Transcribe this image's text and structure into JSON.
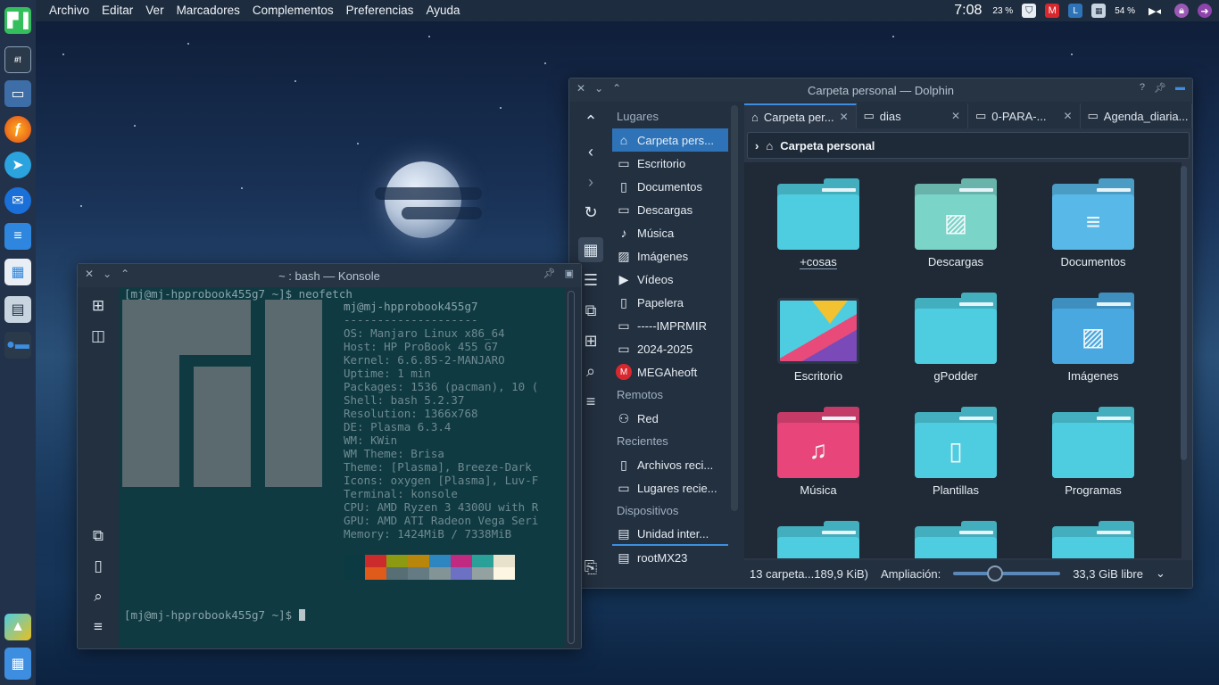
{
  "topbar": {
    "menu": [
      "Archivo",
      "Editar",
      "Ver",
      "Marcadores",
      "Complementos",
      "Preferencias",
      "Ayuda"
    ],
    "clock": "7:08",
    "battery": "23 %",
    "disk": "54 %",
    "tray_icons": [
      "shield-icon",
      "mega-icon",
      "keyboard-layout-icon",
      "calendar-icon",
      "media-icon",
      "lock-icon",
      "updates-icon"
    ]
  },
  "dock": {
    "icons": [
      "manjaro-logo-icon",
      "terminal-icon",
      "file-manager-icon",
      "firefox-icon",
      "telegram-icon",
      "thunderbird-icon",
      "writer-icon",
      "calc-icon",
      "impress-icon",
      "toggle-icon",
      "image-viewer-icon",
      "desktop-pager-icon"
    ]
  },
  "dolphin": {
    "title": "Carpeta personal — Dolphin",
    "places_header": "Lugares",
    "places": [
      {
        "label": "Carpeta pers...",
        "icon": "home-icon"
      },
      {
        "label": "Escritorio",
        "icon": "desktop-icon"
      },
      {
        "label": "Documentos",
        "icon": "document-icon"
      },
      {
        "label": "Descargas",
        "icon": "folder-icon"
      },
      {
        "label": "Música",
        "icon": "music-icon"
      },
      {
        "label": "Imágenes",
        "icon": "image-icon"
      },
      {
        "label": "Vídeos",
        "icon": "video-icon"
      },
      {
        "label": "Papelera",
        "icon": "trash-icon"
      },
      {
        "label": "-----IMPRMIR",
        "icon": "folder-icon"
      },
      {
        "label": "2024-2025",
        "icon": "folder-icon"
      },
      {
        "label": "MEGAheoft",
        "icon": "mega-icon"
      }
    ],
    "remote_header": "Remotos",
    "remote": [
      {
        "label": "Red",
        "icon": "network-icon"
      }
    ],
    "recent_header": "Recientes",
    "recent": [
      {
        "label": "Archivos reci...",
        "icon": "recent-files-icon"
      },
      {
        "label": "Lugares recie...",
        "icon": "recent-places-icon"
      }
    ],
    "devices_header": "Dispositivos",
    "devices": [
      {
        "label": "Unidad inter...",
        "icon": "drive-icon"
      },
      {
        "label": "rootMX23",
        "icon": "drive-icon"
      }
    ],
    "tabs": [
      {
        "label": "Carpeta per...",
        "icon": "home-icon"
      },
      {
        "label": "dias",
        "icon": "folder-icon"
      },
      {
        "label": "0-PARA-...",
        "icon": "folder-icon"
      },
      {
        "label": "Agenda_diaria...",
        "icon": "folder-icon"
      }
    ],
    "breadcrumb": "Carpeta personal",
    "items": [
      {
        "label": "+cosas",
        "kind": "folder",
        "color": "#4fcde0"
      },
      {
        "label": "Descargas",
        "kind": "folder-image",
        "color": "#7ad4c8"
      },
      {
        "label": "Documentos",
        "kind": "folder-doc",
        "color": "#58b8e8"
      },
      {
        "label": "Escritorio",
        "kind": "desktop",
        "color": "#4fcde0"
      },
      {
        "label": "gPodder",
        "kind": "folder",
        "color": "#4fcde0"
      },
      {
        "label": "Imágenes",
        "kind": "folder-image",
        "color": "#4aa8e0"
      },
      {
        "label": "Música",
        "kind": "folder-music",
        "color": "#e8457a"
      },
      {
        "label": "Plantillas",
        "kind": "folder-template",
        "color": "#4fcde0"
      },
      {
        "label": "Programas",
        "kind": "folder",
        "color": "#4fcde0"
      },
      {
        "label": "",
        "kind": "folder",
        "color": "#4fcde0"
      },
      {
        "label": "",
        "kind": "folder",
        "color": "#4fcde0"
      },
      {
        "label": "",
        "kind": "folder",
        "color": "#4fcde0"
      }
    ],
    "status": {
      "summary": "13 carpeta...189,9 KiB)",
      "zoom_label": "Ampliación:",
      "zoom_value": 0.35,
      "free": "33,3 GiB libre"
    }
  },
  "konsole": {
    "title": "~ : bash — Konsole",
    "prompt": "[mj@mj-hpprobook455g7 ~]$ neofetch",
    "prompt2": "[mj@mj-hpprobook455g7 ~]$ ",
    "info": [
      "mj@mj-hpprobook455g7",
      "--------------------",
      "OS: Manjaro Linux x86_64",
      "Host: HP ProBook 455 G7",
      "Kernel: 6.6.85-2-MANJARO",
      "Uptime: 1 min",
      "Packages: 1536 (pacman), 10 (",
      "Shell: bash 5.2.37",
      "Resolution: 1366x768",
      "DE: Plasma 6.3.4",
      "WM: KWin",
      "WM Theme: Brisa",
      "Theme: [Plasma], Breeze-Dark",
      "Icons: oxygen [Plasma], Luv-F",
      "Terminal: konsole",
      "CPU: AMD Ryzen 3 4300U with R",
      "GPU: AMD ATI Radeon Vega Seri",
      "Memory: 1424MiB / 7338MiB"
    ],
    "palette_top": [
      "#0c3a42",
      "#cc2b2b",
      "#8c9a12",
      "#b8860b",
      "#2e86c1",
      "#c02a80",
      "#2aa198",
      "#e8e2cc"
    ],
    "palette_bottom": [
      "#0c3a42",
      "#e05a1a",
      "#586e75",
      "#657b83",
      "#839496",
      "#6c71c4",
      "#93a1a1",
      "#fdf6e3"
    ]
  },
  "colors": {
    "accent": "#3d8ee0",
    "topbar": "#1d2d3f",
    "terminal_bg": "#0f3a42"
  }
}
